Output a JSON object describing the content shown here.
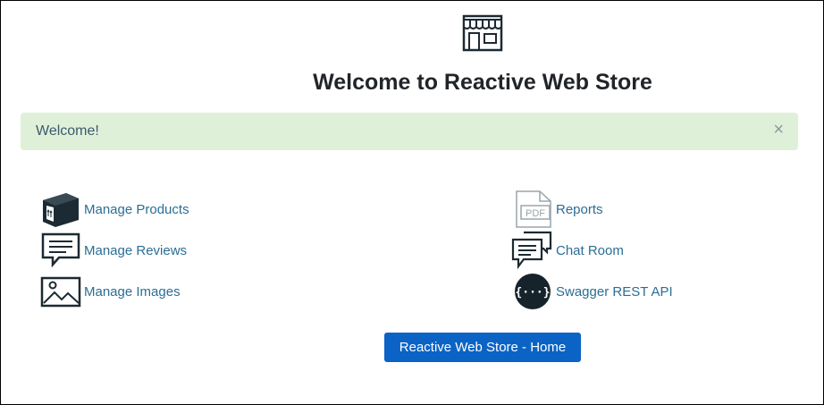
{
  "page": {
    "title": "Welcome to Reactive Web Store"
  },
  "alert": {
    "message": "Welcome!",
    "close_symbol": "×",
    "background_color": "#dff0d8"
  },
  "links": {
    "left": [
      {
        "label": "Manage Products",
        "icon": "box-icon"
      },
      {
        "label": "Manage Reviews",
        "icon": "speech-bubble-icon"
      },
      {
        "label": "Manage Images",
        "icon": "image-icon"
      }
    ],
    "right": [
      {
        "label": "Reports",
        "icon": "pdf-file-icon",
        "icon_text": "PDF"
      },
      {
        "label": "Chat Room",
        "icon": "chat-bubbles-icon"
      },
      {
        "label": "Swagger REST API",
        "icon": "swagger-icon",
        "icon_text": "{···}"
      }
    ]
  },
  "home_button": {
    "label": "Reactive Web Store - Home",
    "color": "#0b63c5"
  },
  "colors": {
    "link": "#2a6e94",
    "title": "#212529"
  }
}
